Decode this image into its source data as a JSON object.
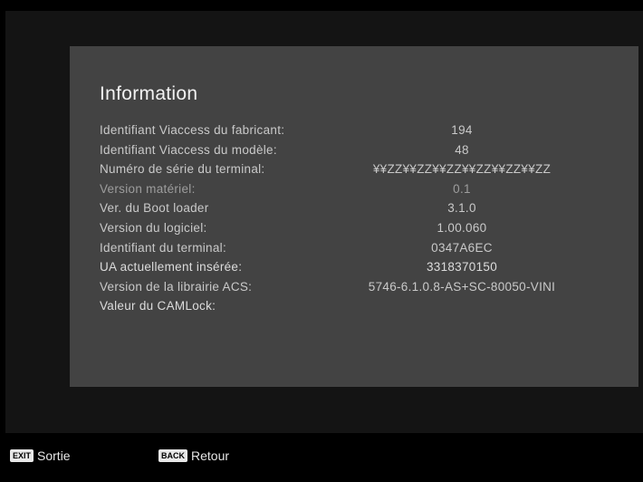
{
  "panel": {
    "title": "Information",
    "rows": [
      {
        "label": "Identifiant Viaccess du fabricant:",
        "value": "194"
      },
      {
        "label": "Identifiant Viaccess du modèle:",
        "value": "48"
      },
      {
        "label": "Numéro de série du terminal:",
        "value": "¥¥ZZ¥¥ZZ¥¥ZZ¥¥ZZ¥¥ZZ¥¥ZZ"
      },
      {
        "label": "Version matériel:",
        "value": "0.1"
      },
      {
        "label": "Ver. du Boot loader",
        "value": "3.1.0"
      },
      {
        "label": "Version du logiciel:",
        "value": "1.00.060"
      },
      {
        "label": "Identifiant du terminal:",
        "value": "0347A6EC"
      },
      {
        "label": "UA actuellement insérée:",
        "value": "3318370150"
      },
      {
        "label": "Version de la librairie ACS:",
        "value": "5746-6.1.0.8-AS+SC-80050-VINI"
      },
      {
        "label": "Valeur du CAMLock:",
        "value": ""
      }
    ]
  },
  "footer": {
    "exit_key": "EXIT",
    "exit_label": "Sortie",
    "back_key": "BACK",
    "back_label": "Retour"
  }
}
